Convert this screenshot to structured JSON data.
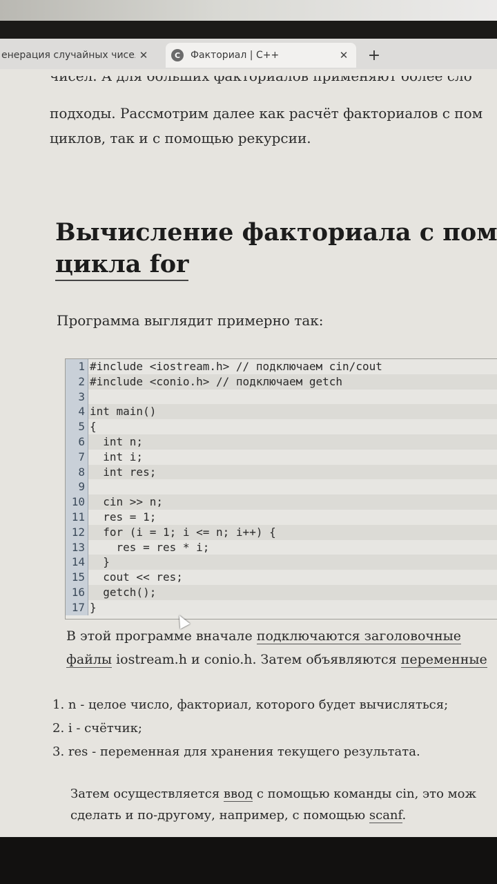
{
  "tabs": [
    {
      "title": "енерация случайных чисел в С",
      "close": "✕"
    },
    {
      "favicon": "C",
      "title": "Факториал | С++",
      "close": "✕"
    }
  ],
  "new_tab": "+",
  "article": {
    "intro_cut": "чисел. А для больших факториалов применяют более сло",
    "intro_line2": "подходы. Рассмотрим далее как расчёт факториалов с пом",
    "intro_line3": "циклов, так и с помощью рекурсии.",
    "heading_line1": "Вычисление факториала с помо",
    "heading_line2": "цикла for",
    "lead": "Программа выглядит примерно так:",
    "code_lines": [
      {
        "n": "1",
        "text": "#include <iostream.h> // подключаем cin/cout"
      },
      {
        "n": "2",
        "text": "#include <conio.h> // подключаем getch"
      },
      {
        "n": "3",
        "text": ""
      },
      {
        "n": "4",
        "text": "int main()"
      },
      {
        "n": "5",
        "text": "{"
      },
      {
        "n": "6",
        "text": "  int n;"
      },
      {
        "n": "7",
        "text": "  int i;"
      },
      {
        "n": "8",
        "text": "  int res;"
      },
      {
        "n": "9",
        "text": ""
      },
      {
        "n": "10",
        "text": "  cin >> n;"
      },
      {
        "n": "11",
        "text": "  res = 1;"
      },
      {
        "n": "12",
        "text": "  for (i = 1; i <= n; i++) {"
      },
      {
        "n": "13",
        "text": "    res = res * i;"
      },
      {
        "n": "14",
        "text": "  }"
      },
      {
        "n": "15",
        "text": "  cout << res;"
      },
      {
        "n": "16",
        "text": "  getch();"
      },
      {
        "n": "17",
        "text": "}"
      }
    ],
    "after_p1": "В этой программе вначале ",
    "after_link1": "подключаются заголовочные",
    "after_link1b": "файлы",
    "after_p2": " iostream.h и conio.h.  Затем объявляются ",
    "after_link2": "переменные",
    "list": [
      "1. n - целое число, факториал, которого будет вычисляться;",
      "2. i - счётчик;",
      "3. res - переменная для хранения текущего результата."
    ],
    "outro_p1": "Затем осуществляется ",
    "outro_link1": "ввод",
    "outro_p2": " с помощью команды cin, это мож",
    "outro_p3": "сделать и по-другому, например, с помощью ",
    "outro_link2": "scanf",
    "outro_p4": "."
  }
}
